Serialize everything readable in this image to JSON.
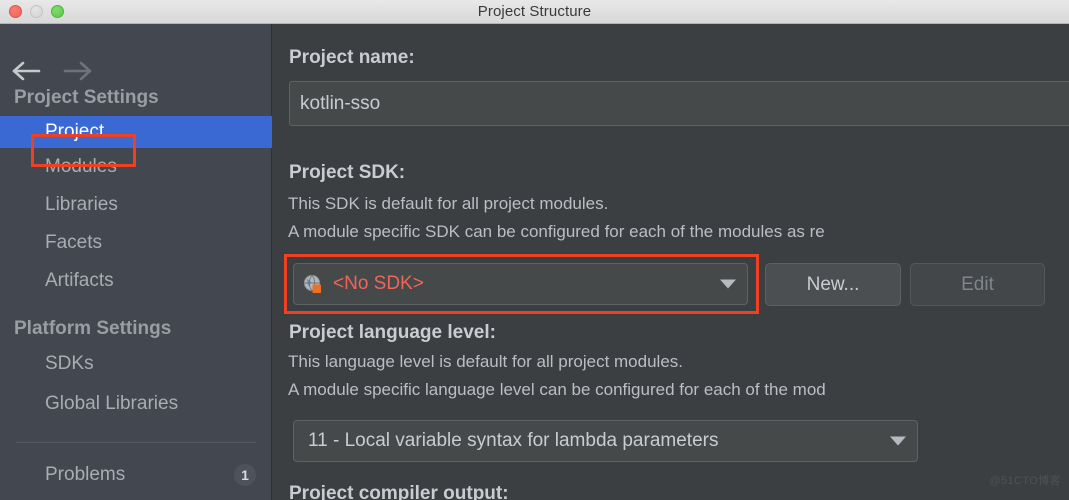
{
  "window": {
    "title": "Project Structure",
    "controls": {
      "close": "close-window",
      "minimize": "minimize-window",
      "maximize": "maximize-window"
    }
  },
  "navigation": {
    "back": "back-arrow",
    "forward": "forward-arrow"
  },
  "sidebar": {
    "groups": [
      {
        "header": "Project Settings",
        "items": [
          {
            "label": "Project",
            "selected": true,
            "badge": null
          },
          {
            "label": "Modules",
            "selected": false,
            "badge": null
          },
          {
            "label": "Libraries",
            "selected": false,
            "badge": null
          },
          {
            "label": "Facets",
            "selected": false,
            "badge": null
          },
          {
            "label": "Artifacts",
            "selected": false,
            "badge": null
          }
        ]
      },
      {
        "header": "Platform Settings",
        "items": [
          {
            "label": "SDKs",
            "selected": false,
            "badge": null
          },
          {
            "label": "Global Libraries",
            "selected": false,
            "badge": null
          }
        ]
      },
      {
        "header": null,
        "items": [
          {
            "label": "Problems",
            "selected": false,
            "badge": "1"
          }
        ]
      }
    ]
  },
  "main": {
    "project_name": {
      "label": "Project name:",
      "value": "kotlin-sso",
      "placeholder": "Project name"
    },
    "project_sdk": {
      "label": "Project SDK:",
      "desc_line_1": "This SDK is default for all project modules.",
      "desc_line_2": "A module specific SDK can be configured for each of the modules as re",
      "selected": "<No SDK>",
      "icon": "globe-warning-icon",
      "new_button": "New...",
      "edit_button": "Edit"
    },
    "language_level": {
      "label": "Project language level:",
      "desc_line_1": "This language level is default for all project modules.",
      "desc_line_2": "A module specific language level can be configured for each of the mod",
      "selected": "11 - Local variable syntax for lambda parameters"
    },
    "compiler_output": {
      "label": "Project compiler output:"
    }
  },
  "watermark": "@51CTO博客",
  "colors": {
    "titlebar": "#e4e4e4",
    "sidebar_bg": "#434750",
    "content_bg": "#3c3f41",
    "selection_blue": "#3a69d4",
    "annotation_red": "#f04022",
    "error_text_red": "#f0645a",
    "sdk_badge_orange": "#ee7022",
    "text_primary": "#c9ccd1",
    "text_muted": "#9a9da3"
  }
}
